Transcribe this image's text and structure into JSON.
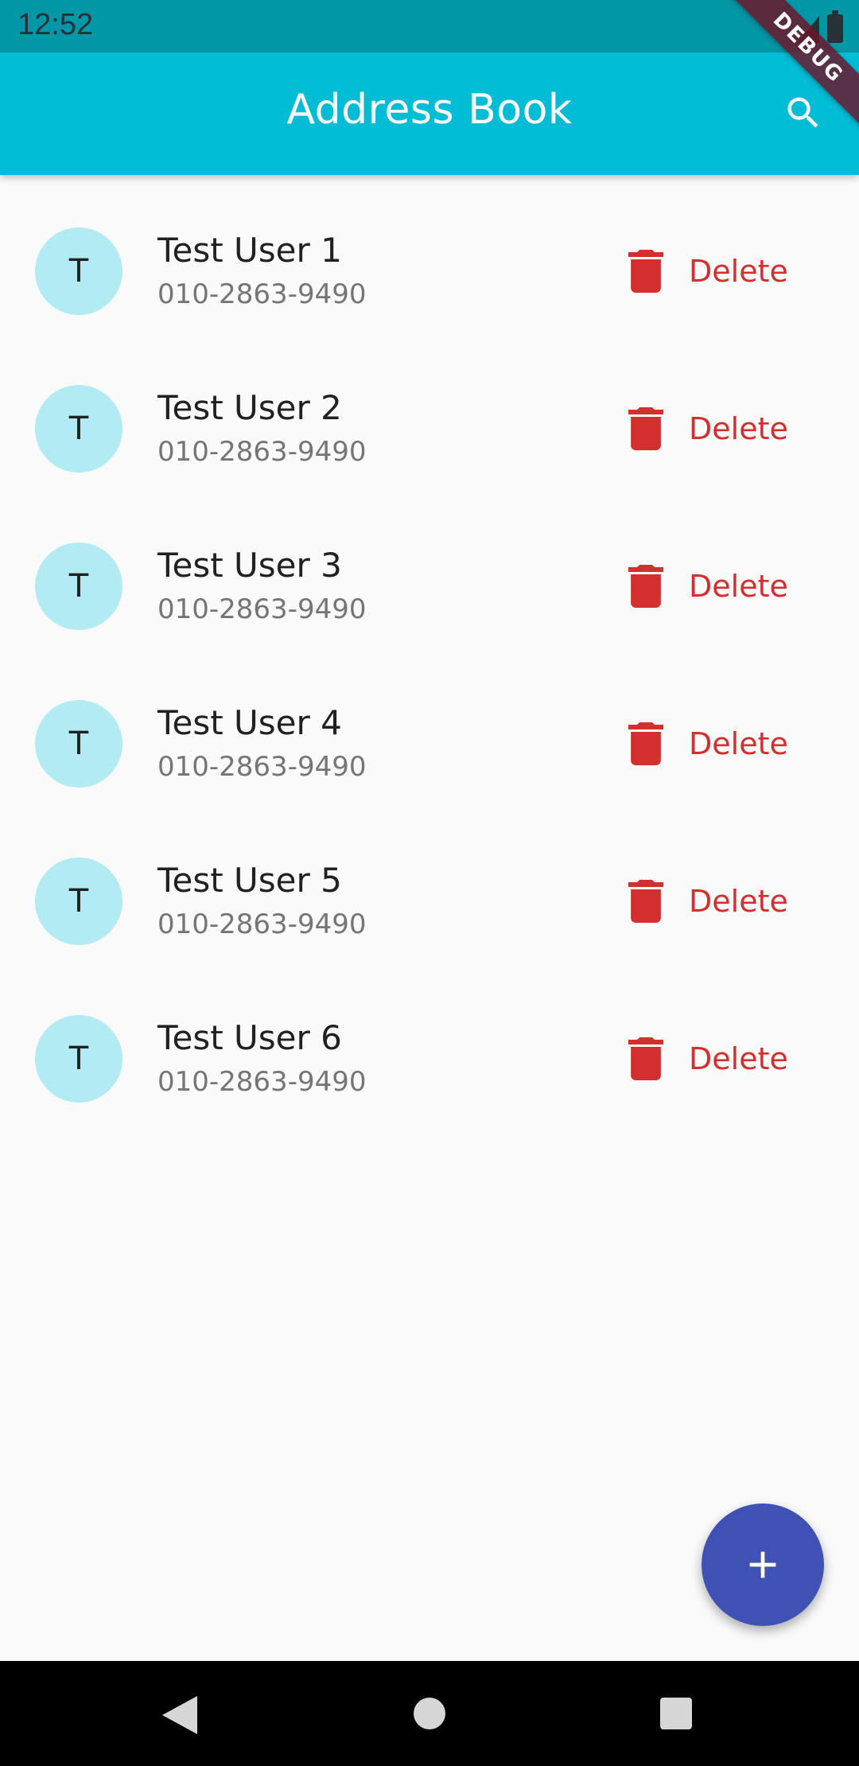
{
  "status_bar": {
    "time": "12:52",
    "icons": [
      "signal-icon",
      "battery-icon"
    ]
  },
  "app_bar": {
    "title": "Address Book",
    "search_icon": "search-icon",
    "debug_banner": "DEBUG"
  },
  "contacts": [
    {
      "initial": "T",
      "name": "Test User 1",
      "phone": "010-2863-9490",
      "delete_label": "Delete"
    },
    {
      "initial": "T",
      "name": "Test User 2",
      "phone": "010-2863-9490",
      "delete_label": "Delete"
    },
    {
      "initial": "T",
      "name": "Test User 3",
      "phone": "010-2863-9490",
      "delete_label": "Delete"
    },
    {
      "initial": "T",
      "name": "Test User 4",
      "phone": "010-2863-9490",
      "delete_label": "Delete"
    },
    {
      "initial": "T",
      "name": "Test User 5",
      "phone": "010-2863-9490",
      "delete_label": "Delete"
    },
    {
      "initial": "T",
      "name": "Test User 6",
      "phone": "010-2863-9490",
      "delete_label": "Delete"
    }
  ],
  "fab": {
    "icon": "add-icon"
  },
  "nav_bar": {
    "icons": [
      "back-icon",
      "home-icon",
      "recents-icon"
    ]
  },
  "colors": {
    "status_bar": "#0097a7",
    "app_bar": "#00bcd4",
    "avatar": "#b2ebf2",
    "delete": "#d32f2f",
    "fab": "#3f51b5",
    "background": "#fafafa"
  }
}
